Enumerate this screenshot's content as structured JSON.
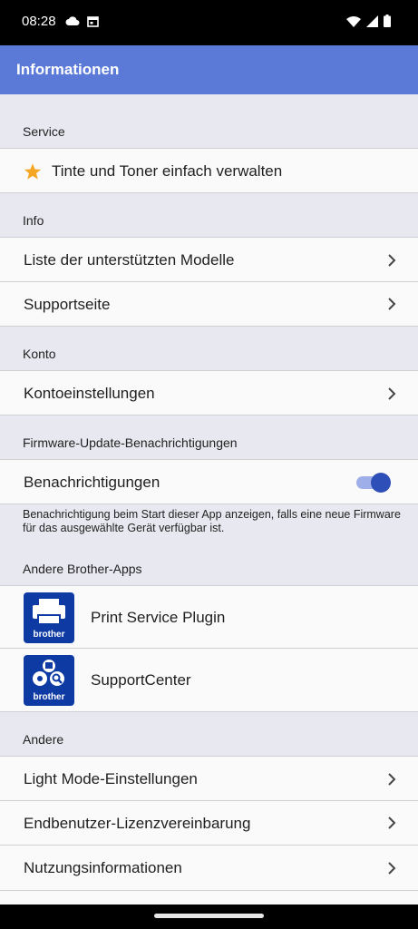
{
  "status_bar": {
    "time": "08:28",
    "left_icons": [
      "cloud-icon",
      "calendar-icon"
    ],
    "right_icons": [
      "wifi-icon",
      "signal-icon",
      "battery-icon"
    ]
  },
  "app_bar": {
    "title": "Informationen"
  },
  "sections": {
    "service": {
      "header": "Service",
      "item": "Tinte und Toner einfach verwalten"
    },
    "info": {
      "header": "Info",
      "items": [
        "Liste der unterstützten Modelle",
        "Supportseite"
      ]
    },
    "konto": {
      "header": "Konto",
      "items": [
        "Kontoeinstellungen"
      ]
    },
    "firmware": {
      "header": "Firmware-Update-Benachrichtigungen",
      "toggle_label": "Benachrichtigungen",
      "toggle_on": true,
      "hint": "Benachrichtigung beim Start dieser App anzeigen, falls eine neue Firmware für das ausgewählte Gerät verfügbar ist."
    },
    "apps": {
      "header": "Andere Brother-Apps",
      "items": [
        {
          "name": "Print Service Plugin",
          "icon_label": "brother",
          "icon": "printer-icon"
        },
        {
          "name": "SupportCenter",
          "icon_label": "brother",
          "icon": "support-center-icon"
        }
      ]
    },
    "andere": {
      "header": "Andere",
      "items": [
        "Light Mode-Einstellungen",
        "Endbenutzer-Lizenzvereinbarung",
        "Nutzungsinformationen"
      ]
    }
  },
  "colors": {
    "app_bar": "#5b7ad8",
    "accent": "#2f4fb8",
    "star": "#f5a623",
    "brand_icon": "#0d3aa3"
  }
}
